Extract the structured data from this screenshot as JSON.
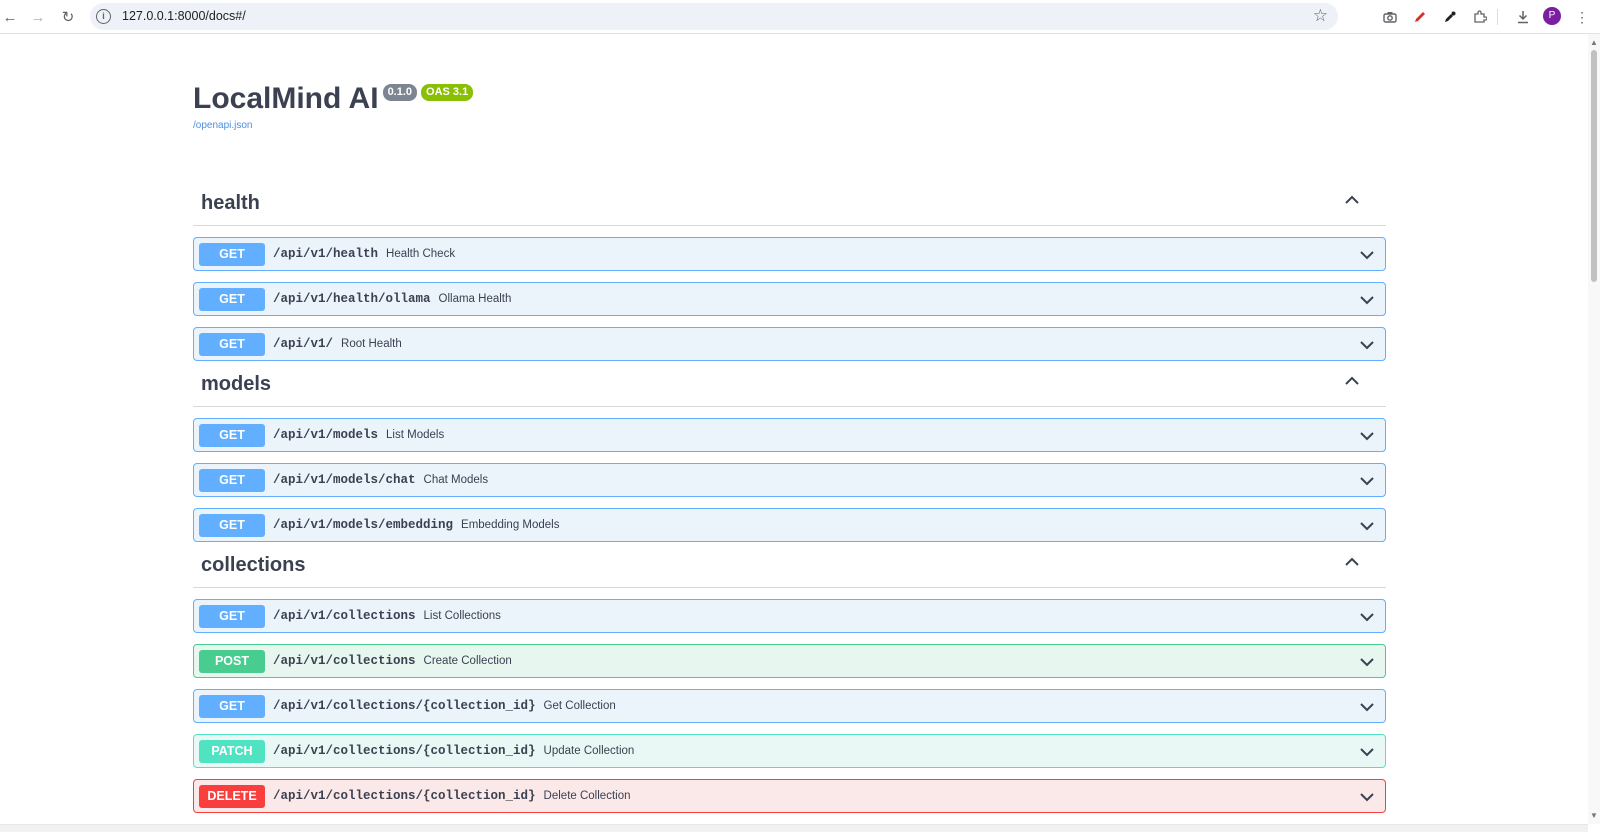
{
  "browser": {
    "url": "127.0.0.1:8000/docs#/",
    "profile_initial": "P"
  },
  "header": {
    "title": "LocalMind AI",
    "version_badge": "0.1.0",
    "oas_badge": "OAS 3.1",
    "spec_link": "/openapi.json"
  },
  "colors": {
    "get": "#61affe",
    "post": "#49cc90",
    "patch": "#50e3c2",
    "delete": "#f93e3e"
  },
  "sections": [
    {
      "title": "health",
      "operations": [
        {
          "method": "GET",
          "path": "/api/v1/health",
          "summary": "Health Check"
        },
        {
          "method": "GET",
          "path": "/api/v1/health/ollama",
          "summary": "Ollama Health"
        },
        {
          "method": "GET",
          "path": "/api/v1/",
          "summary": "Root Health"
        }
      ]
    },
    {
      "title": "models",
      "operations": [
        {
          "method": "GET",
          "path": "/api/v1/models",
          "summary": "List Models"
        },
        {
          "method": "GET",
          "path": "/api/v1/models/chat",
          "summary": "Chat Models"
        },
        {
          "method": "GET",
          "path": "/api/v1/models/embedding",
          "summary": "Embedding Models"
        }
      ]
    },
    {
      "title": "collections",
      "operations": [
        {
          "method": "GET",
          "path": "/api/v1/collections",
          "summary": "List Collections"
        },
        {
          "method": "POST",
          "path": "/api/v1/collections",
          "summary": "Create Collection"
        },
        {
          "method": "GET",
          "path": "/api/v1/collections/{collection_id}",
          "summary": "Get Collection"
        },
        {
          "method": "PATCH",
          "path": "/api/v1/collections/{collection_id}",
          "summary": "Update Collection"
        },
        {
          "method": "DELETE",
          "path": "/api/v1/collections/{collection_id}",
          "summary": "Delete Collection"
        }
      ]
    }
  ]
}
